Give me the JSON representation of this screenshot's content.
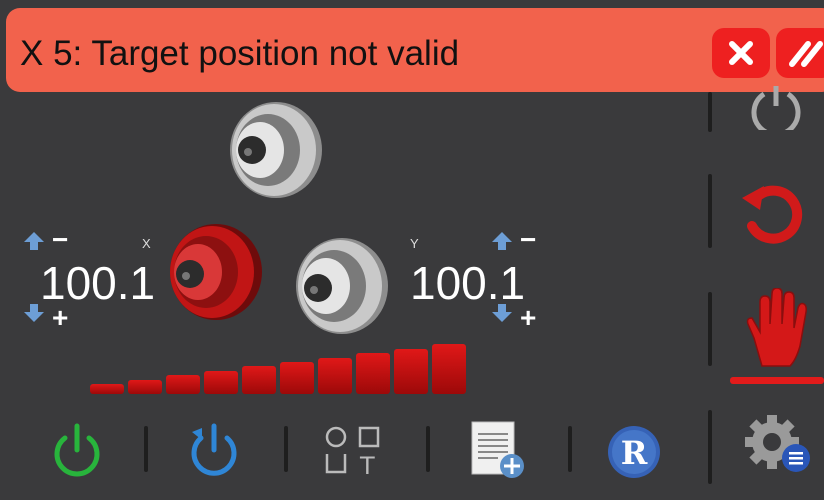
{
  "alert": {
    "message": "X 5: Target position not valid",
    "close_icon": "close-icon",
    "acknowledge_icon": "double-slash-icon"
  },
  "axes": {
    "x": {
      "label": "X",
      "value": "100.1",
      "minus": "−",
      "plus": "+"
    },
    "y": {
      "label": "Y",
      "value": "100.1",
      "minus": "−",
      "plus": "+"
    }
  },
  "speed_levels": {
    "count": 10,
    "active": 10
  },
  "side_panel": [
    {
      "name": "power-icon",
      "active": false
    },
    {
      "name": "rotate-icon",
      "active": false
    },
    {
      "name": "manual-hand-icon",
      "active": true
    },
    {
      "name": "settings-gear-icon",
      "active": false
    }
  ],
  "bottom_toolbar": [
    {
      "name": "power-on-icon"
    },
    {
      "name": "restart-icon"
    },
    {
      "name": "shapes-icon",
      "shape_text": "T"
    },
    {
      "name": "new-document-icon"
    },
    {
      "name": "r-logo-icon",
      "letter": "R"
    }
  ],
  "colors": {
    "alert": "#f2624c",
    "accent": "#e21b1b",
    "bg": "#3a3a3c"
  }
}
